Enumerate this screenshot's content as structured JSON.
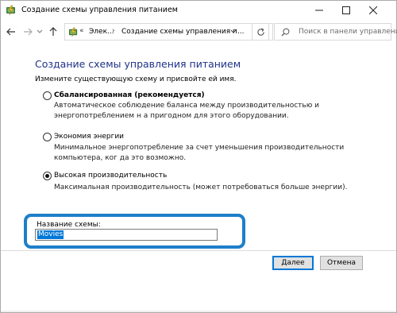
{
  "window": {
    "title": "Создание схемы управления питанием",
    "icon": "power-options-icon"
  },
  "nav": {
    "back_icon": "arrow-left-icon",
    "forward_icon": "arrow-right-icon",
    "recent_icon": "chevron-down-icon",
    "up_icon": "arrow-up-icon",
    "address": {
      "separator": "«",
      "crumbs": [
        "Элек...",
        "Создание схемы управления п..."
      ],
      "crumb_separator": "›"
    },
    "refresh_icon": "refresh-icon",
    "search": {
      "placeholder": "Поиск в панели управления"
    }
  },
  "main": {
    "title": "Создание схемы управления питанием",
    "subtitle": "Измените существующую схему и присвойте ей имя.",
    "options": [
      {
        "label": "Сбалансированная (рекомендуется)",
        "description": "Автоматическое соблюдение баланса между производительностью и энергопотреблением н а пригодном для этого оборудовании.",
        "selected": false,
        "bold": true
      },
      {
        "label": "Экономия энергии",
        "description": "Минимальное энергопотребление за счет уменьшения производительности компьютера, ког да это возможно.",
        "selected": false,
        "bold": false
      },
      {
        "label": "Высокая производительность",
        "description": "Максимальная производительность (может потребоваться больше энергии).",
        "selected": true,
        "bold": false
      }
    ],
    "name_field": {
      "label": "Название схемы:",
      "value": "Movies"
    }
  },
  "footer": {
    "next_label": "Далее",
    "cancel_label": "Отмена"
  },
  "colors": {
    "title_blue": "#1e3287",
    "highlight_border": "#1e7fc8",
    "selection": "#0078d7"
  }
}
